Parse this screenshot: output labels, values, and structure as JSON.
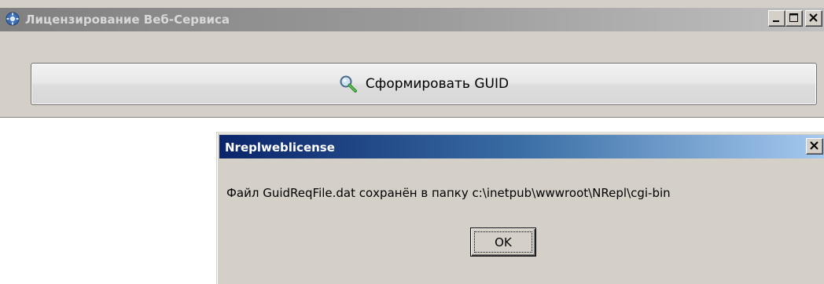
{
  "main_window": {
    "title": "Лицензирование Веб-Сервиса",
    "icon": "gear-app-icon",
    "controls": [
      "minimize",
      "maximize",
      "close"
    ],
    "generate_button_label": "Сформировать GUID",
    "generate_button_icon": "search-icon"
  },
  "dialog": {
    "title": "Nreplweblicense",
    "message": "Файл GuidReqFile.dat сохранён в папку c:\\inetpub\\wwwroot\\NRepl\\cgi-bin",
    "ok_label": "OK"
  },
  "colors": {
    "dialog_title_start": "#0a246a",
    "dialog_title_end": "#a6caf0",
    "inactive_title_start": "#808080",
    "window_face": "#d4d0c8"
  }
}
